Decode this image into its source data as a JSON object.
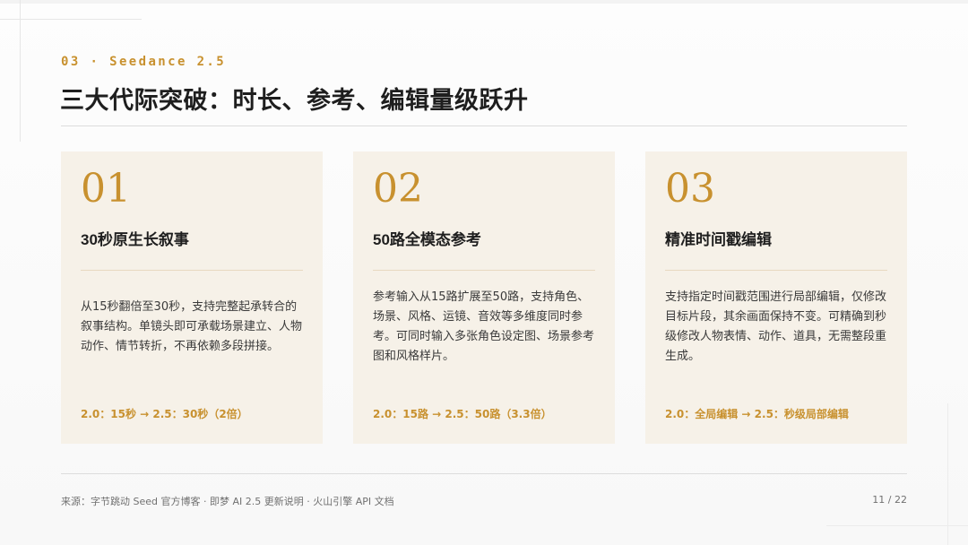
{
  "header": {
    "eyebrow": "03 · Seedance 2.5",
    "title": "三大代际突破：时长、参考、编辑量级跃升"
  },
  "cards": [
    {
      "number": "01",
      "heading": "30秒原生长叙事",
      "body": "从15秒翻倍至30秒，支持完整起承转合的叙事结构。单镜头即可承载场景建立、人物动作、情节转折，不再依赖多段拼接。",
      "compare": "2.0：15秒 → 2.5：30秒（2倍）"
    },
    {
      "number": "02",
      "heading": "50路全模态参考",
      "body": "参考输入从15路扩展至50路，支持角色、场景、风格、运镜、音效等多维度同时参考。可同时输入多张角色设定图、场景参考图和风格样片。",
      "compare": "2.0：15路 → 2.5：50路（3.3倍）"
    },
    {
      "number": "03",
      "heading": "精准时间戳编辑",
      "body": "支持指定时间戳范围进行局部编辑，仅修改目标片段，其余画面保持不变。可精确到秒级修改人物表情、动作、道具，无需整段重生成。",
      "compare": "2.0：全局编辑 → 2.5：秒级局部编辑"
    }
  ],
  "footer": {
    "source": "来源：字节跳动 Seed 官方博客 · 即梦 AI 2.5 更新说明 · 火山引擎 API 文档",
    "page": "11 / 22"
  },
  "colors": {
    "accent": "#c8912f",
    "card_bg": "#f6f1e8",
    "divider": "#e8d9c0"
  }
}
